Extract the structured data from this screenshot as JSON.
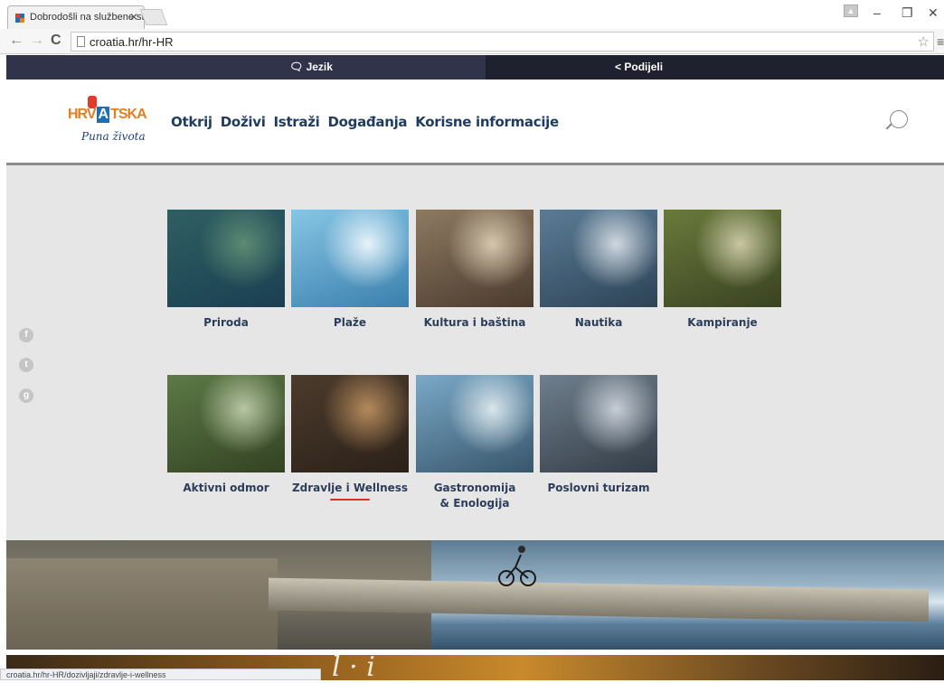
{
  "browser": {
    "tab_title": "Dobrodošli na službene st",
    "url": "croatia.hr/hr-HR",
    "status_url": "croatia.hr/hr-HR/dozivljaji/zdravlje-i-wellness"
  },
  "sharebar": {
    "language_label": "Jezik",
    "share_label": "Podijeli"
  },
  "logo": {
    "top_left": "HRV",
    "top_a": "A",
    "top_right": "TSKA",
    "tagline": "Puna života"
  },
  "nav": {
    "items": [
      "Otkrij",
      "Doživi",
      "Istraži",
      "Događanja",
      "Korisne informacije"
    ]
  },
  "menu": {
    "cards": [
      {
        "label": "Priroda",
        "colors": [
          "#2f5f62",
          "#5c8a73",
          "#1a3f52"
        ]
      },
      {
        "label": "Plaže",
        "colors": [
          "#87c6e4",
          "#e6f3fa",
          "#3a7fae"
        ]
      },
      {
        "label": "Kultura i baština",
        "colors": [
          "#8d7a62",
          "#d6c6ac",
          "#4b3b2e"
        ]
      },
      {
        "label": "Nautika",
        "colors": [
          "#5b7c96",
          "#cfd8e0",
          "#2d4356"
        ]
      },
      {
        "label": "Kampiranje",
        "colors": [
          "#6a7a3c",
          "#c8c7a3",
          "#3a4221"
        ]
      },
      {
        "label": "Aktivni odmor",
        "colors": [
          "#5d7a46",
          "#b7c6a4",
          "#334223"
        ]
      },
      {
        "label": "Zdravlje i Wellness",
        "colors": [
          "#4c3b2c",
          "#b58a5c",
          "#2b2119"
        ]
      },
      {
        "label": "Gastronomija & Enologija",
        "colors": [
          "#7aa9c8",
          "#d9e5ec",
          "#38566b"
        ]
      },
      {
        "label": "Poslovni turizam",
        "colors": [
          "#6f7f8d",
          "#c6ced6",
          "#343d47"
        ]
      }
    ],
    "hovered_label": "Zdravlje i Wellness"
  },
  "social": {
    "icons": [
      "facebook-icon",
      "twitter-icon",
      "googleplus-icon"
    ]
  },
  "hero": {
    "overlay_text": "l · i"
  }
}
